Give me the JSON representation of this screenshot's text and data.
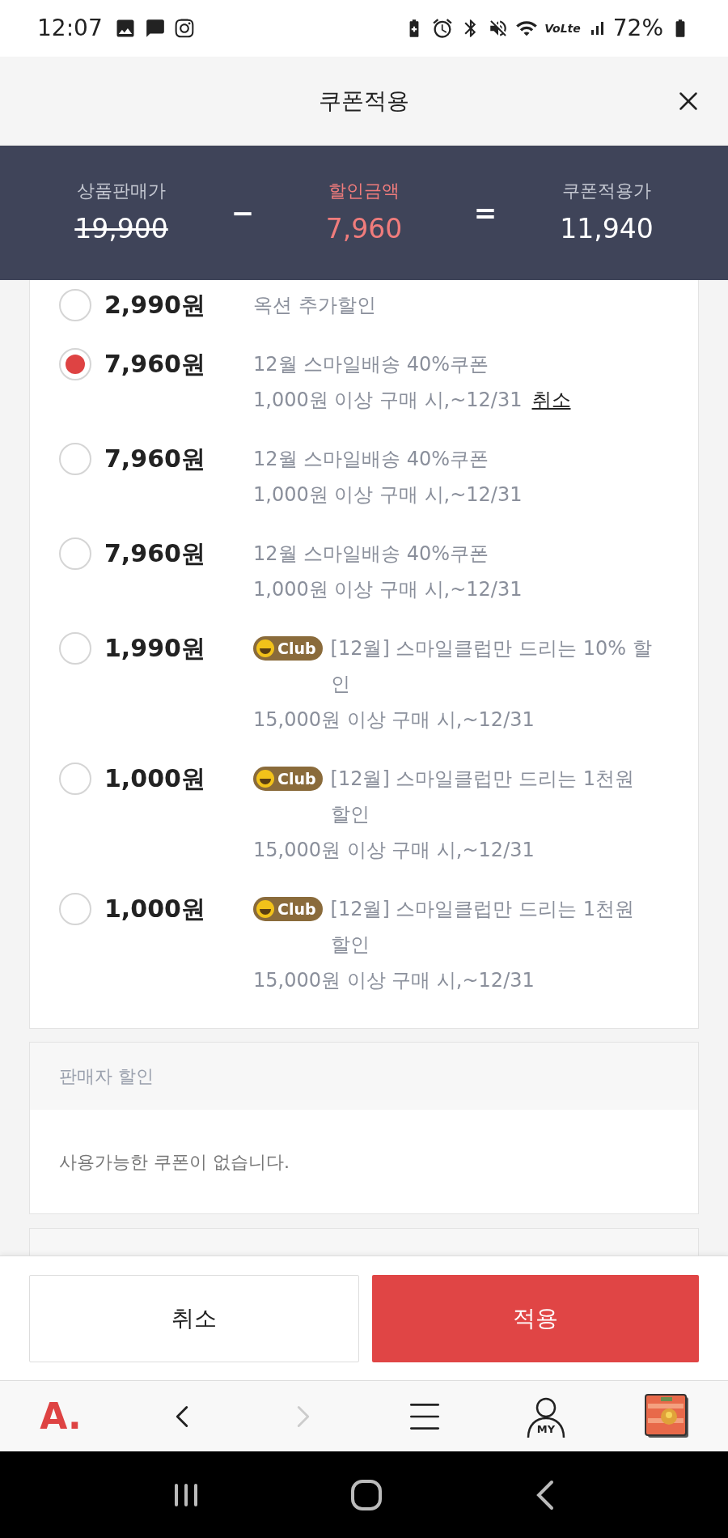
{
  "status_bar": {
    "time": "12:07",
    "network_label": "VoLte",
    "battery": "72%"
  },
  "header": {
    "title": "쿠폰적용"
  },
  "summary": {
    "items": [
      {
        "kind": "original",
        "label": "상품판매가",
        "value": "19,900"
      },
      {
        "kind": "operator",
        "value": "−"
      },
      {
        "kind": "discount",
        "label": "할인금액",
        "value": "7,960"
      },
      {
        "kind": "operator",
        "value": "="
      },
      {
        "kind": "final",
        "label": "쿠폰적용가",
        "value": "11,940"
      }
    ]
  },
  "coupons": [
    {
      "amount": "2,990원",
      "title": "옥션 추가할인",
      "selected": false
    },
    {
      "amount": "7,960원",
      "title": "12월 스마일배송 40%쿠폰",
      "condition": "1,000원 이상 구매 시,~12/31",
      "cancel_link": "취소",
      "selected": true
    },
    {
      "amount": "7,960원",
      "title": "12월 스마일배송 40%쿠폰",
      "condition": "1,000원 이상 구매 시,~12/31",
      "selected": false
    },
    {
      "amount": "7,960원",
      "title": "12월 스마일배송 40%쿠폰",
      "condition": "1,000원 이상 구매 시,~12/31",
      "selected": false
    },
    {
      "amount": "1,990원",
      "badge": "Club",
      "title": "[12월] 스마일클럽만 드리는 10% 할인",
      "condition": "15,000원 이상 구매 시,~12/31",
      "selected": false
    },
    {
      "amount": "1,000원",
      "badge": "Club",
      "title": "[12월] 스마일클럽만 드리는 1천원 할인",
      "condition": "15,000원 이상 구매 시,~12/31",
      "selected": false
    },
    {
      "amount": "1,000원",
      "badge": "Club",
      "title": "[12월] 스마일클럽만 드리는 1천원 할인",
      "condition": "15,000원 이상 구매 시,~12/31",
      "selected": false
    }
  ],
  "seller_section": {
    "title": "판매자 할인",
    "message": "사용가능한 쿠폰이 없습니다."
  },
  "buttons": [
    {
      "kind": "secondary",
      "label": "취소"
    },
    {
      "kind": "primary",
      "label": "적용"
    }
  ],
  "nav_bar": {
    "logo": "A.",
    "my_label": "MY",
    "forward_disabled": true
  }
}
